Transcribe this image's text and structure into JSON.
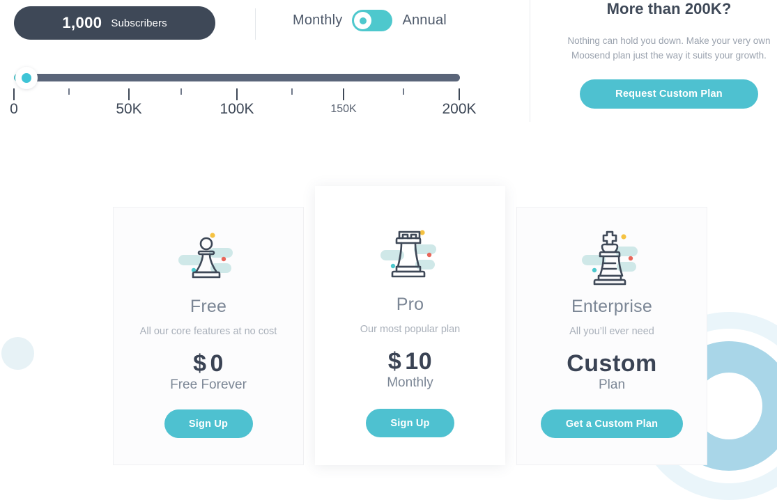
{
  "subscriber_pill": {
    "count": "1,000",
    "label": "Subscribers"
  },
  "billing": {
    "monthly_label": "Monthly",
    "annual_label": "Annual",
    "selected": "Monthly"
  },
  "slider": {
    "value": "1,000",
    "min": "0",
    "max": "200K",
    "ticks": [
      {
        "label": "0",
        "major": true
      },
      {
        "label": "",
        "major": false
      },
      {
        "label": "50K",
        "major": true
      },
      {
        "label": "",
        "major": false
      },
      {
        "label": "100K",
        "major": true
      },
      {
        "label": "",
        "major": false
      },
      {
        "label": "150K",
        "major": true
      },
      {
        "label": "",
        "major": false
      },
      {
        "label": "200K",
        "major": true
      }
    ]
  },
  "promo": {
    "title": "More than 200K?",
    "text": "Nothing can hold you down. Make your very own Moosend plan just the way it suits your growth.",
    "button": "Request Custom Plan"
  },
  "plans": [
    {
      "name": "Free",
      "description": "All our core features at no cost",
      "price_currency": "$",
      "price_amount": "0",
      "price_period": "Free Forever",
      "button": "Sign Up",
      "icon": "chess-pawn-icon"
    },
    {
      "name": "Pro",
      "description": "Our most popular plan",
      "price_currency": "$",
      "price_amount": "10",
      "price_period": "Monthly",
      "button": "Sign Up",
      "icon": "chess-rook-icon"
    },
    {
      "name": "Enterprise",
      "description": "All you’ll ever need",
      "price_currency": "",
      "price_amount": "Custom",
      "price_period": "Plan",
      "button": "Get a Custom Plan",
      "icon": "chess-king-icon"
    }
  ],
  "colors": {
    "teal": "#4ec1d0",
    "navy": "#3e4857",
    "muted": "#a9b0ba",
    "icon_blob": "#cfe8e8",
    "dot_yellow": "#f5c242",
    "dot_red": "#e8665a",
    "dot_teal": "#4ec8cd"
  }
}
